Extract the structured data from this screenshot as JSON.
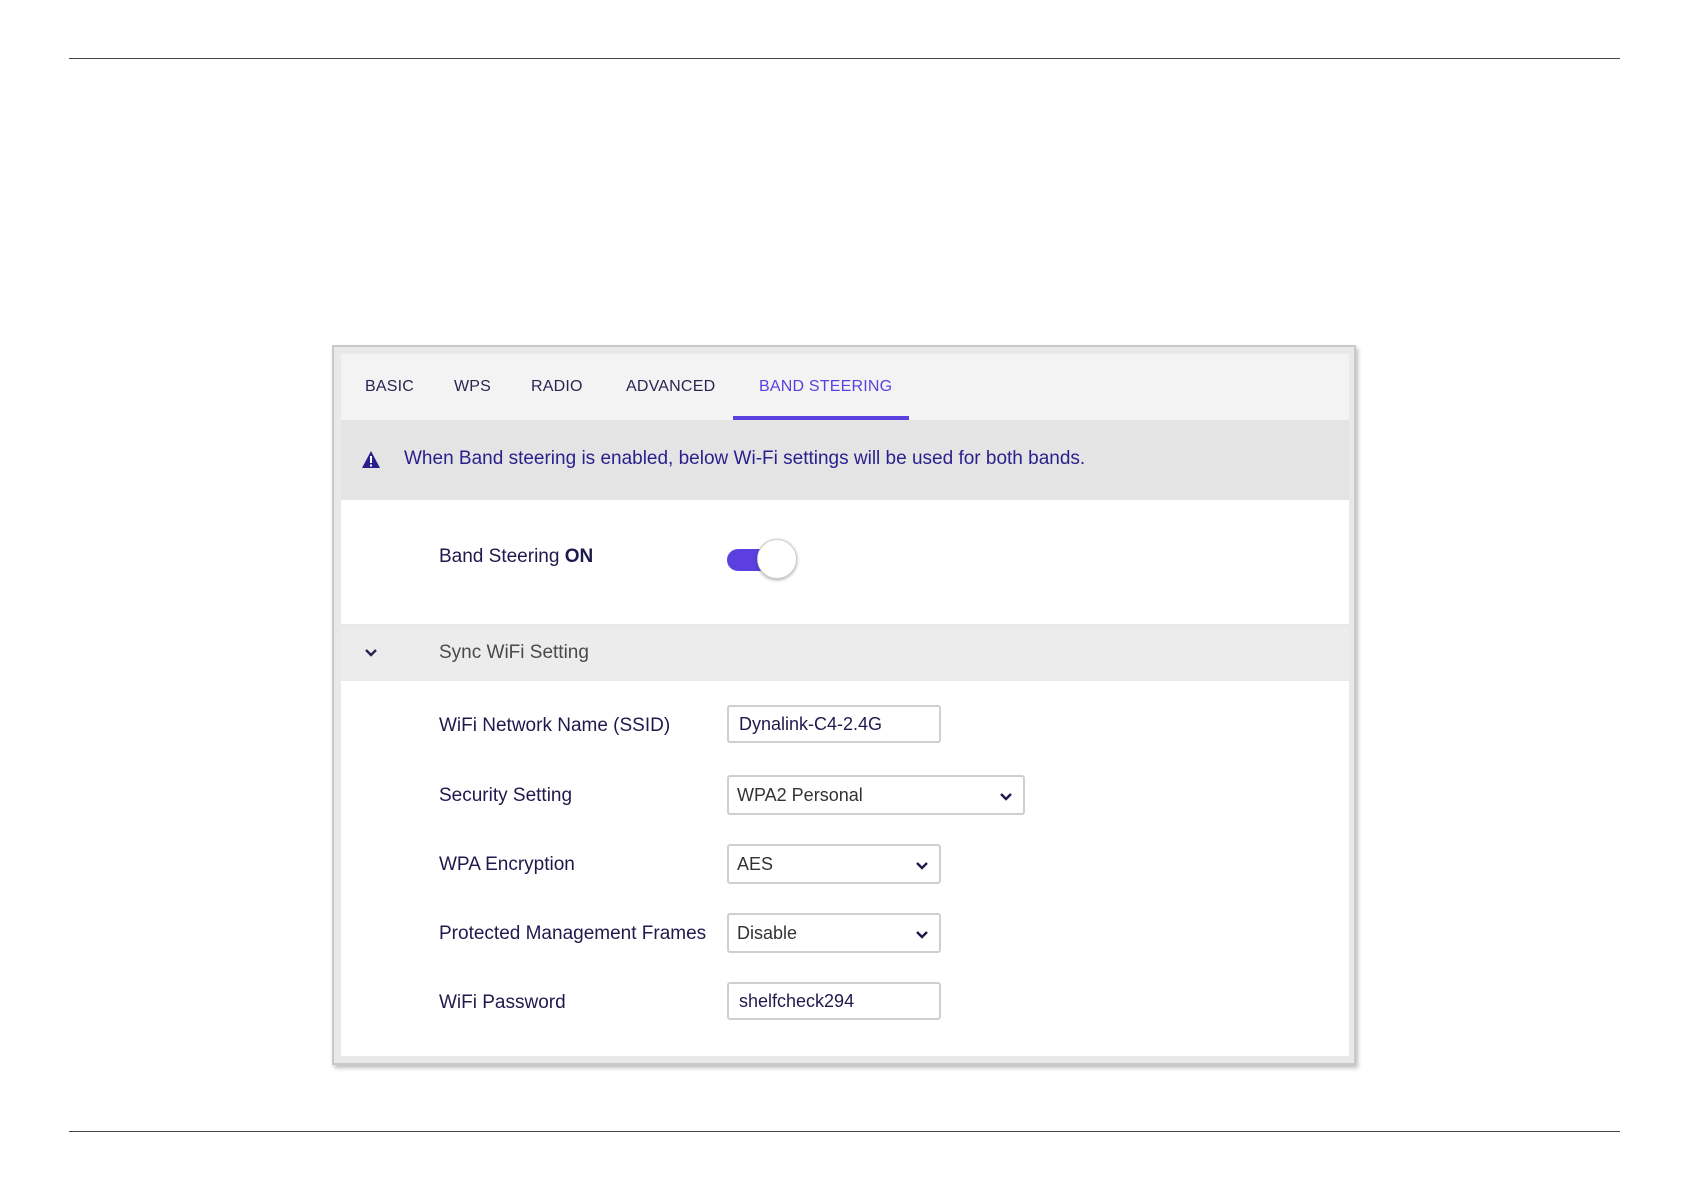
{
  "tabs": [
    {
      "label": "BASIC"
    },
    {
      "label": "WPS"
    },
    {
      "label": "RADIO"
    },
    {
      "label": "ADVANCED"
    },
    {
      "label": "BAND STEERING"
    }
  ],
  "active_tab": "BAND STEERING",
  "notice": {
    "icon": "warning-icon",
    "text": "When Band steering is enabled, below Wi-Fi settings will be used for both bands."
  },
  "band_steering": {
    "label": "Band Steering",
    "state_text": "ON",
    "enabled": true
  },
  "section": {
    "title": "Sync WiFi Setting",
    "expanded": true
  },
  "form": {
    "ssid_label": "WiFi Network Name (SSID)",
    "ssid_value": "Dynalink-C4-2.4G",
    "security_label": "Security Setting",
    "security_value": "WPA2 Personal",
    "encryption_label": "WPA Encryption",
    "encryption_value": "AES",
    "pmf_label": "Protected Management Frames",
    "pmf_value": "Disable",
    "password_label": "WiFi Password",
    "password_value": "shelfcheck294"
  },
  "colors": {
    "accent": "#5b3fe0",
    "notice_text": "#2a1f8c",
    "text": "#1f1a4d"
  }
}
